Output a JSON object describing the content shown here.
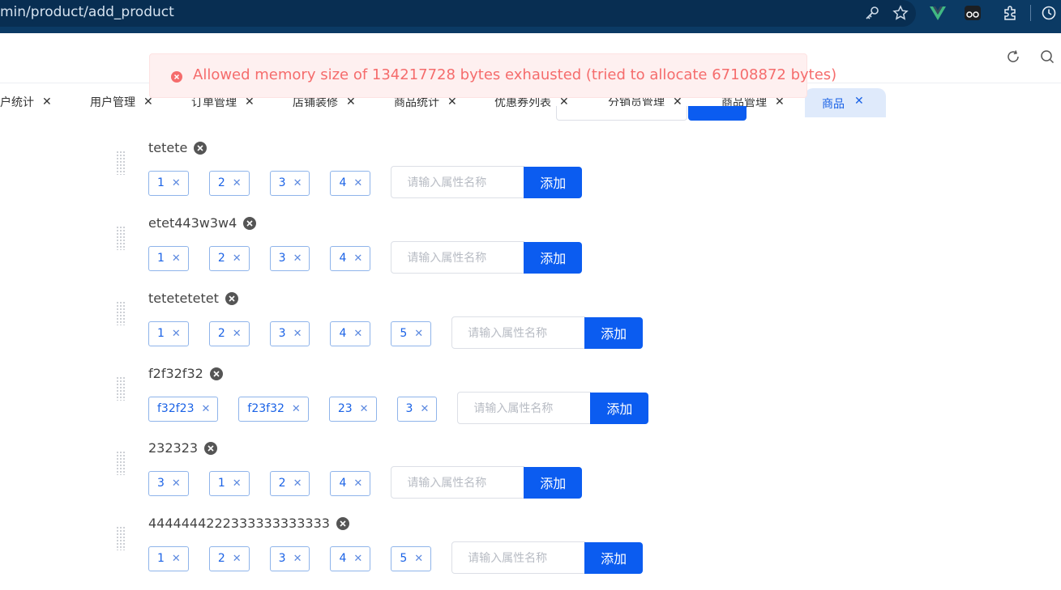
{
  "browser": {
    "url": "min/product/add_product"
  },
  "toast": {
    "message": "Allowed memory size of 134217728 bytes exhausted (tried to allocate 67108872 bytes)",
    "color": "#f56c6c"
  },
  "tabs": [
    {
      "label": "户统计",
      "close": "✕"
    },
    {
      "label": "用户管理",
      "close": "✕"
    },
    {
      "label": "订单管理",
      "close": "✕"
    },
    {
      "label": "店铺装修",
      "close": "✕"
    },
    {
      "label": "商品统计",
      "close": "✕"
    },
    {
      "label": "优惠券列表",
      "close": "✕"
    },
    {
      "label": "分销员管理",
      "close": "✕"
    },
    {
      "label": "商品管理",
      "close": "✕"
    }
  ],
  "active_tab": {
    "label": "商品",
    "close": "✕"
  },
  "groups": [
    {
      "name": "tetete",
      "values": [
        "1",
        "2",
        "3",
        "4"
      ]
    },
    {
      "name": "etet443w3w4",
      "values": [
        "1",
        "2",
        "3",
        "4"
      ]
    },
    {
      "name": "tetetetetet",
      "values": [
        "1",
        "2",
        "3",
        "4",
        "5"
      ]
    },
    {
      "name": "f2f32f32",
      "values": [
        "f32f23",
        "f23f32",
        "23",
        "3"
      ]
    },
    {
      "name": "232323",
      "values": [
        "3",
        "1",
        "2",
        "4"
      ]
    },
    {
      "name": "4444444222333333333333",
      "values": [
        "1",
        "2",
        "3",
        "4",
        "5"
      ]
    }
  ],
  "add_input_placeholder": "请输入属性名称",
  "add_button_label": "添加",
  "tag_close": "✕",
  "colors": {
    "accent": "#0b5cf0",
    "browser_bar": "#0b3a64"
  }
}
